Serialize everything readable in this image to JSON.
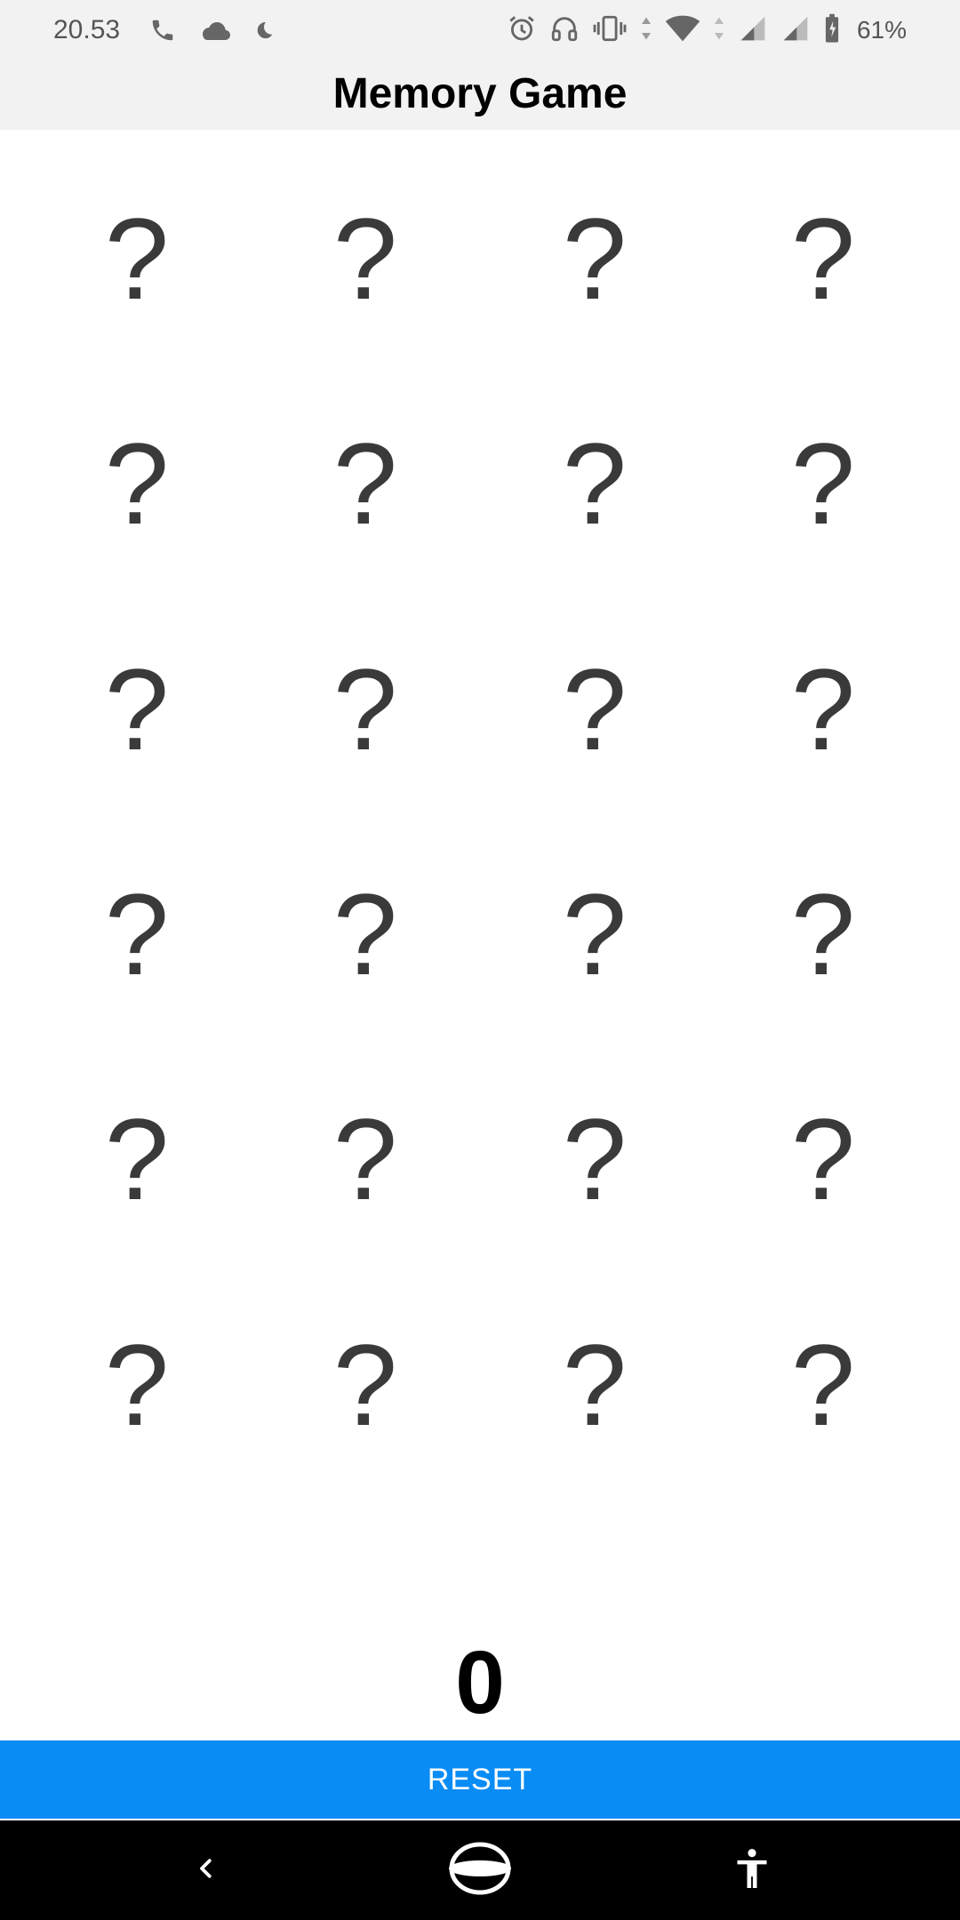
{
  "status_bar": {
    "time": "20.53",
    "battery_percent": "61%",
    "left_icons": [
      "phone-icon",
      "cloud-icon",
      "moon-icon"
    ],
    "right_icons": [
      "alarm-icon",
      "headphones-icon",
      "vibrate-icon",
      "wifi-icon",
      "signal-icon",
      "signal-icon",
      "battery-icon"
    ]
  },
  "header": {
    "title": "Memory Game"
  },
  "grid": {
    "rows": 6,
    "columns": 4,
    "cards": [
      "?",
      "?",
      "?",
      "?",
      "?",
      "?",
      "?",
      "?",
      "?",
      "?",
      "?",
      "?",
      "?",
      "?",
      "?",
      "?",
      "?",
      "?",
      "?",
      "?",
      "?",
      "?",
      "?",
      "?"
    ]
  },
  "score": "0",
  "reset_label": "RESET",
  "colors": {
    "reset_button": "#0a8cf5",
    "header_background": "#f2f2f2",
    "card_glyph": "#3a3a3a"
  },
  "nav_bar": {
    "icons": [
      "back-icon",
      "home-icon",
      "accessibility-icon"
    ]
  }
}
